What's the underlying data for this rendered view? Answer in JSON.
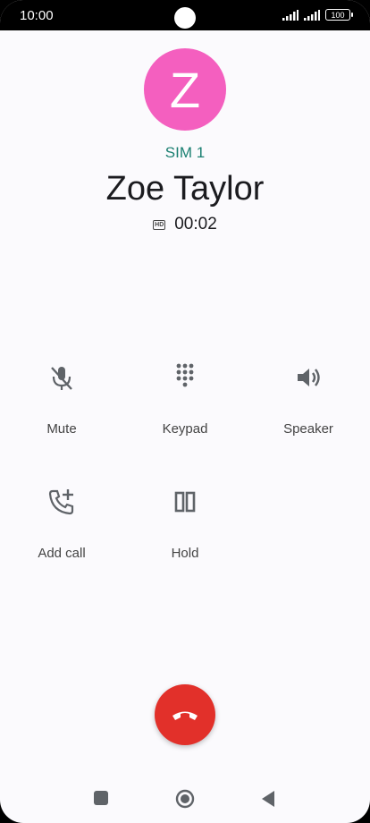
{
  "status_bar": {
    "time": "10:00",
    "battery": "100"
  },
  "contact": {
    "initial": "Z",
    "sim": "SIM 1",
    "name": "Zoe Taylor",
    "duration": "00:02",
    "avatar_color": "#f45fbf"
  },
  "actions": [
    {
      "label": "Mute",
      "icon": "mic-off-icon"
    },
    {
      "label": "Keypad",
      "icon": "dialpad-icon"
    },
    {
      "label": "Speaker",
      "icon": "volume-icon"
    },
    {
      "label": "Add call",
      "icon": "add-call-icon"
    },
    {
      "label": "Hold",
      "icon": "pause-icon"
    }
  ],
  "end_call": {
    "icon": "call-end-icon",
    "color": "#e2302a"
  },
  "nav": [
    "recents-icon",
    "home-icon",
    "back-icon"
  ]
}
